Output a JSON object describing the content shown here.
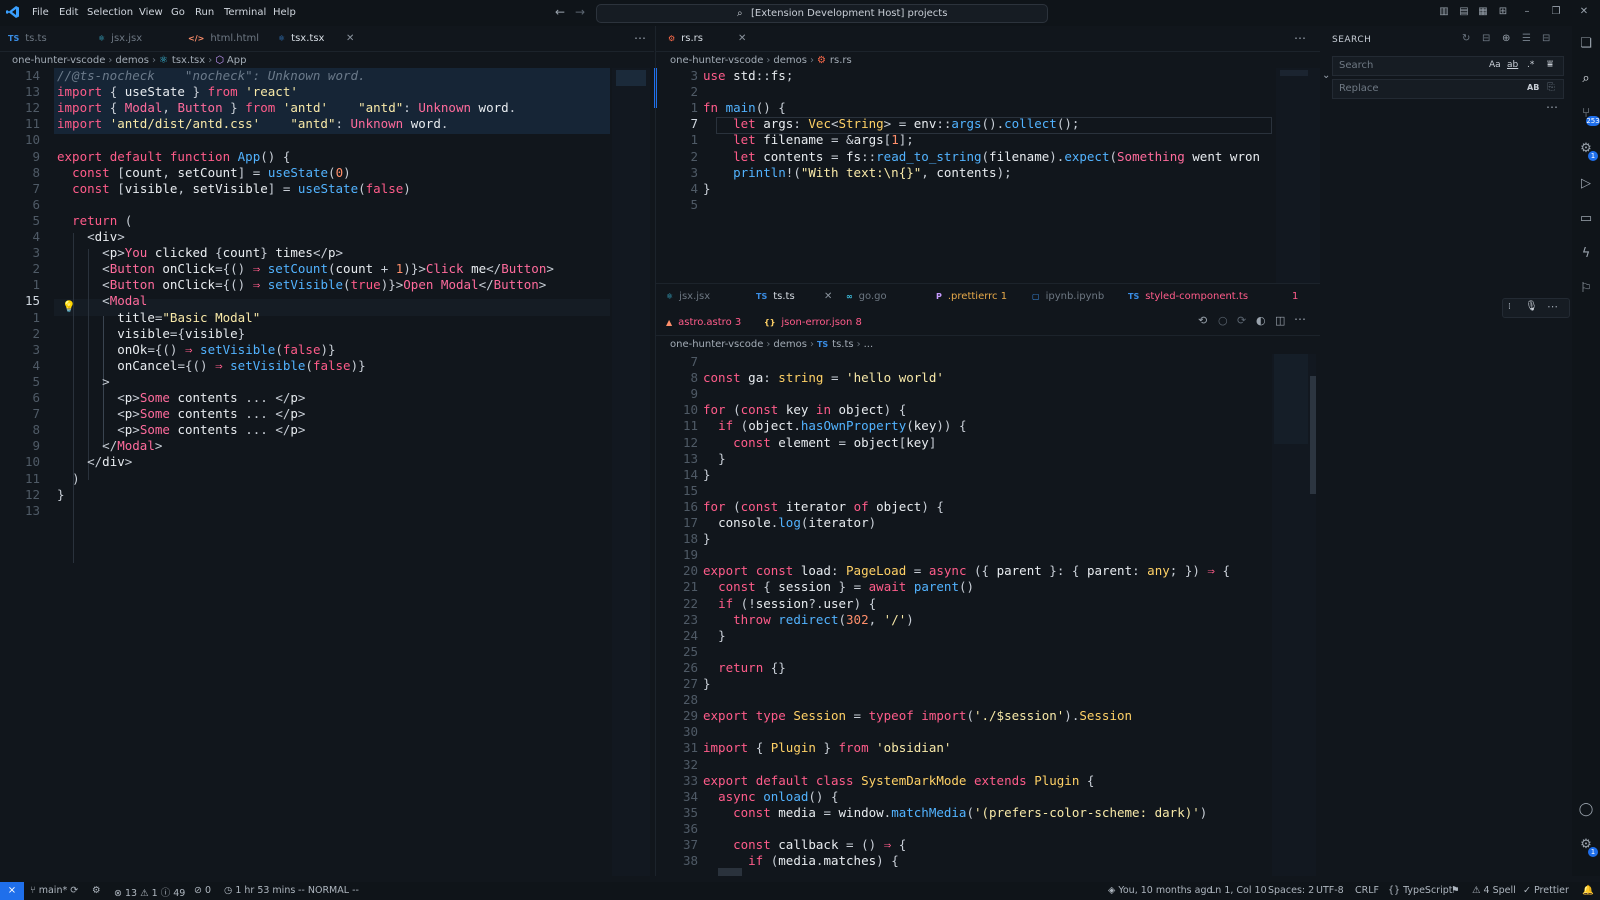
{
  "menu": {
    "items": [
      "File",
      "Edit",
      "Selection",
      "View",
      "Go",
      "Run",
      "Terminal",
      "Help"
    ],
    "command_center": "[Extension Development Host] projects"
  },
  "left_editor": {
    "tabs": [
      {
        "icon": "TS",
        "label": "ts.ts"
      },
      {
        "icon": "⚛",
        "label": "jsx.jsx"
      },
      {
        "icon": "</>",
        "label": "html.html"
      },
      {
        "icon": "⚛",
        "label": "tsx.tsx",
        "active": true
      }
    ],
    "breadcrumb": [
      "one-hunter-vscode",
      "demos",
      "tsx.tsx",
      "App"
    ],
    "line_numbers": [
      "14",
      "13",
      "12",
      "11",
      "10",
      "9",
      "8",
      "7",
      "6",
      "5",
      "4",
      "3",
      "2",
      "1",
      "15",
      "1",
      "2",
      "3",
      "4",
      "5",
      "6",
      "7",
      "8",
      "9",
      "10",
      "11",
      "12",
      "13"
    ],
    "lines": [
      "//@ts-nocheck    \"nocheck\": Unknown word.",
      "import { useState } from 'react'",
      "import { Modal, Button } from 'antd'    \"antd\": Unknown word.",
      "import 'antd/dist/antd.css'    \"antd\": Unknown word.",
      "",
      "export default function App() {",
      "  const [count, setCount] = useState(0)",
      "  const [visible, setVisible] = useState(false)",
      "",
      "  return (",
      "    <div>",
      "      <p>You clicked {count} times</p>",
      "      <Button onClick={() ⇒ setCount(count + 1)}>Click me</Button>",
      "      <Button onClick={() ⇒ setVisible(true)}>Open Modal</Button>",
      "      <Modal",
      "        title=\"Basic Modal\"",
      "        visible={visible}",
      "        onOk={() ⇒ setVisible(false)}",
      "        onCancel={() ⇒ setVisible(false)}",
      "      >",
      "        <p>Some contents ... </p>",
      "        <p>Some contents ... </p>",
      "        <p>Some contents ... </p>",
      "      </Modal>",
      "    </div>",
      "  )",
      "}",
      ""
    ]
  },
  "top_right_editor": {
    "tab": {
      "icon": "⚙",
      "label": "rs.rs"
    },
    "breadcrumb": [
      "one-hunter-vscode",
      "demos",
      "rs.rs"
    ],
    "line_numbers": [
      "3",
      "2",
      "1",
      "7",
      "1",
      "2",
      "3",
      "4",
      "5"
    ],
    "lines": [
      "use std::fs;",
      "",
      "fn main() {",
      "    let args: Vec<String> = env::args().collect();",
      "    let filename = &args[1];",
      "    let contents = fs::read_to_string(filename).expect(\"Something went wron",
      "    println!(\"With text:\\n{}\", contents);",
      "}",
      ""
    ]
  },
  "bottom_right_editor": {
    "tabs_row1": [
      {
        "icon": "⚛",
        "label": "jsx.jsx"
      },
      {
        "icon": "TS",
        "label": "ts.ts",
        "active": true
      },
      {
        "icon": "∞",
        "label": "go.go"
      },
      {
        "icon": "P",
        "label": ".prettierrc 1"
      },
      {
        "icon": "▢",
        "label": "ipynb.ipynb"
      },
      {
        "icon": "TS",
        "label": "styled-component.ts",
        "count": "1"
      }
    ],
    "tabs_row2": [
      {
        "icon": "▲",
        "label": "astro.astro 3"
      },
      {
        "icon": "{}",
        "label": "json-error.json 8"
      }
    ],
    "breadcrumb": [
      "one-hunter-vscode",
      "demos",
      "ts.ts",
      "..."
    ],
    "line_numbers": [
      "7",
      "8",
      "9",
      "10",
      "11",
      "12",
      "13",
      "14",
      "15",
      "16",
      "17",
      "18",
      "19",
      "20",
      "21",
      "22",
      "23",
      "24",
      "25",
      "26",
      "27",
      "28",
      "29",
      "30",
      "31",
      "32",
      "33",
      "34",
      "35",
      "36",
      "37",
      "38"
    ],
    "lines": [
      "",
      "const ga: string = 'hello world'",
      "",
      "for (const key in object) {",
      "  if (object.hasOwnProperty(key)) {",
      "    const element = object[key]",
      "  }",
      "}",
      "",
      "for (const iterator of object) {",
      "  console.log(iterator)",
      "}",
      "",
      "export const load: PageLoad = async ({ parent }: { parent: any; }) ⇒ {",
      "  const { session } = await parent()",
      "  if (!session?.user) {",
      "    throw redirect(302, '/')",
      "  }",
      "",
      "  return {}",
      "}",
      "",
      "export type Session = typeof import('./$session').Session",
      "",
      "import { Plugin } from 'obsidian'",
      "",
      "export default class SystemDarkMode extends Plugin {",
      "  async onload() {",
      "    const media = window.matchMedia('(prefers-color-scheme: dark)')",
      "",
      "    const callback = () ⇒ {",
      "      if (media.matches) {"
    ]
  },
  "search": {
    "title": "SEARCH",
    "search_placeholder": "Search",
    "replace_placeholder": "Replace",
    "toggles": [
      "Aa",
      "ab",
      ".*"
    ],
    "replace_toggle": "AB"
  },
  "status": {
    "branch": "main*",
    "problems": "⊗ 13 ⚠ 1 ⓘ 49",
    "ports": "⊘ 0",
    "time": "1 hr 53 mins",
    "mode": "-- NORMAL --",
    "blame": "You, 10 months ago",
    "cursor": "Ln 1, Col 10",
    "spaces": "Spaces: 2",
    "encoding": "UTF-8",
    "eol": "CRLF",
    "language": "TypeScript",
    "spell": "4 Spell",
    "prettier": "Prettier"
  },
  "colors": {
    "background": "#11161c",
    "keyword": "#ff5c8a",
    "function": "#52b3ff",
    "string": "#f8e9a8",
    "accent": "#1f6feb"
  }
}
